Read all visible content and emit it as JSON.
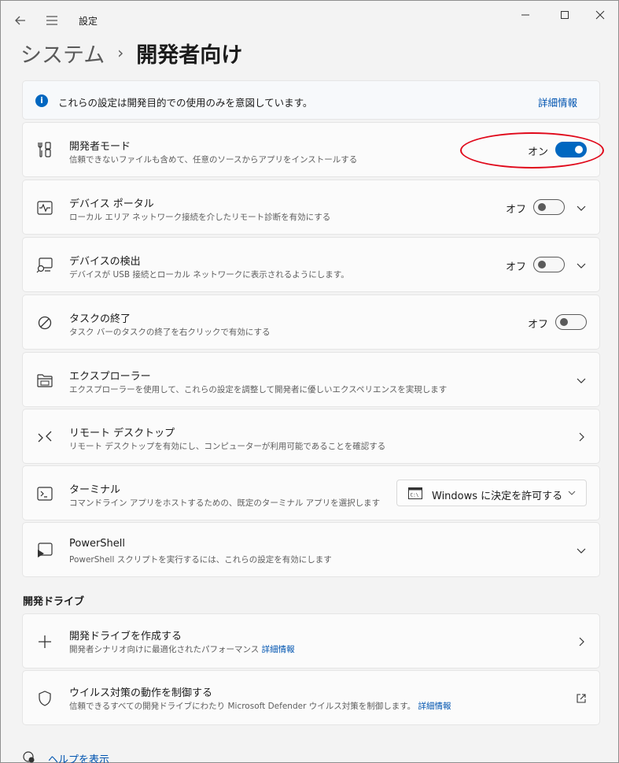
{
  "window": {
    "title": "設定",
    "icons": {
      "back": "back-arrow-icon",
      "menu": "hamburger-menu-icon",
      "minimize": "minimize-icon",
      "maximize": "maximize-icon",
      "close": "close-icon"
    }
  },
  "breadcrumb": {
    "parent": "システム",
    "separator": "›",
    "current": "開発者向け"
  },
  "info": {
    "text": "これらの設定は開発目的での使用のみを意図しています。",
    "link": "詳細情報",
    "icon": "info-icon"
  },
  "settings": {
    "developer_mode": {
      "title": "開発者モード",
      "desc": "信頼できないファイルも含めて、任意のソースからアプリをインストールする",
      "state_label": "オン",
      "toggle_on": true,
      "icon": "developer-tools-icon"
    },
    "device_portal": {
      "title": "デバイス ポータル",
      "desc": "ローカル エリア ネットワーク接続を介したリモート診断を有効にする",
      "state_label": "オフ",
      "toggle_on": false,
      "icon": "device-portal-icon"
    },
    "device_discovery": {
      "title": "デバイスの検出",
      "desc": "デバイスが USB 接続とローカル ネットワークに表示されるようにします。",
      "state_label": "オフ",
      "toggle_on": false,
      "icon": "device-discovery-icon"
    },
    "end_task": {
      "title": "タスクの終了",
      "desc": "タスク バーのタスクの終了を右クリックで有効にする",
      "state_label": "オフ",
      "toggle_on": false,
      "icon": "end-task-icon"
    },
    "explorer": {
      "title": "エクスプローラー",
      "desc": "エクスプローラーを使用して、これらの設定を調整して開発者に優しいエクスペリエンスを実現します",
      "icon": "folder-icon"
    },
    "remote_desktop": {
      "title": "リモート デスクトップ",
      "desc": "リモート デスクトップを有効にし、コンピューターが利用可能であることを確認する",
      "icon": "remote-desktop-icon"
    },
    "terminal": {
      "title": "ターミナル",
      "desc": "コマンドライン アプリをホストするための、既定のターミナル アプリを選択します",
      "dropdown_value": "Windows に決定を許可する",
      "icon": "terminal-icon"
    },
    "powershell": {
      "title": "PowerShell",
      "desc": "PowerShell スクリプトを実行するには、これらの設定を有効にします",
      "icon": "powershell-icon"
    }
  },
  "dev_drive": {
    "section_title": "開発ドライブ",
    "create": {
      "title": "開発ドライブを作成する",
      "desc": "開発者シナリオ向けに最適化されたパフォーマンス",
      "link": "詳細情報",
      "icon": "plus-icon"
    },
    "antivirus": {
      "title": "ウイルス対策の動作を制御する",
      "desc": "信頼できるすべての開発ドライブにわたり Microsoft Defender ウイルス対策を制御します。",
      "link": "詳細情報",
      "icon": "shield-icon"
    }
  },
  "help": {
    "text": "ヘルプを表示",
    "icon": "help-icon"
  },
  "colors": {
    "accent": "#0067c0",
    "link": "#0054b0",
    "annotation": "#e0081a"
  }
}
